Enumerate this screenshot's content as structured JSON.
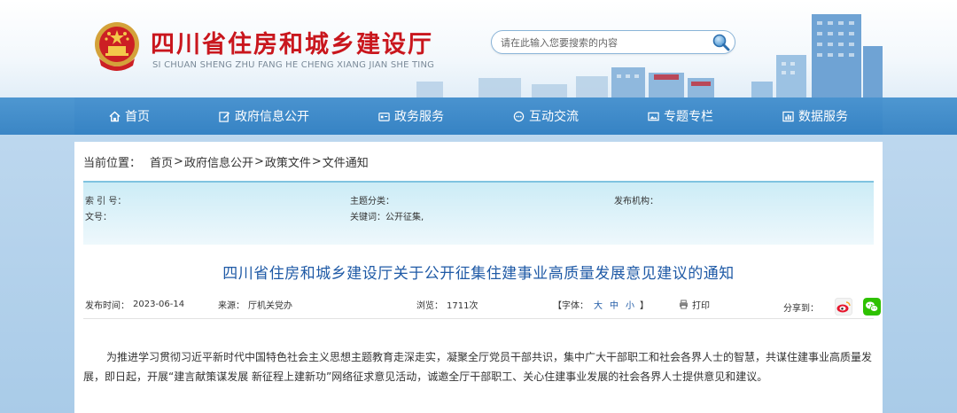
{
  "header": {
    "site_title": "四川省住房和城乡建设厅",
    "site_pinyin": "SI CHUAN SHENG ZHU FANG HE CHENG XIANG JIAN SHE TING",
    "emblem_icon": "national-emblem-icon",
    "search": {
      "placeholder": "请在此输入您要搜索的内容",
      "button_icon": "search-icon"
    }
  },
  "nav": {
    "items": [
      {
        "label": "首页",
        "icon": "home-icon"
      },
      {
        "label": "政府信息公开",
        "icon": "edit-icon"
      },
      {
        "label": "政务服务",
        "icon": "card-icon"
      },
      {
        "label": "互动交流",
        "icon": "chat-icon"
      },
      {
        "label": "专题专栏",
        "icon": "picture-icon"
      },
      {
        "label": "数据服务",
        "icon": "chart-icon"
      }
    ]
  },
  "breadcrumb": {
    "label": "当前位置：",
    "items": [
      "首页",
      "政府信息公开",
      "政策文件",
      "文件通知"
    ],
    "separator": ">"
  },
  "meta": {
    "index_label": "索 引 号：",
    "index_value": "",
    "category_label": "主题分类：",
    "category_value": "",
    "publisher_label": "发布机构：",
    "publisher_value": "",
    "doc_no_label": "文号：",
    "doc_no_value": "",
    "keywords_label": "关键词：",
    "keywords_value": "公开征集,"
  },
  "document": {
    "title": "四川省住房和城乡建设厅关于公开征集住建事业高质量发展意见建议的通知",
    "publish_date_label": "发布时间：",
    "publish_date": "2023-06-14",
    "source_label": "来源：",
    "source": "厅机关党办",
    "views_label": "浏览：",
    "views": "1711次",
    "font_label": "【字体：",
    "font_large": "大",
    "font_medium": "中",
    "font_small": "小",
    "font_close": "】",
    "print_label": "打印",
    "share_label": "分享到：",
    "share_icons": [
      "weibo-icon",
      "wechat-icon"
    ],
    "body": "为推进学习贯彻习近平新时代中国特色社会主义思想主题教育走深走实，凝聚全厅党员干部共识，集中广大干部职工和社会各界人士的智慧，共谋住建事业高质量发展，即日起，开展“建言献策谋发展 新征程上建新功”网络征求意见活动，诚邀全厅干部职工、关心住建事业发展的社会各界人士提供意见和建议。"
  },
  "colors": {
    "brand_red": "#c9161d",
    "nav_blue": "#3b86c5",
    "title_blue": "#1f5aa6",
    "meta_bg": "#ccecf6"
  }
}
